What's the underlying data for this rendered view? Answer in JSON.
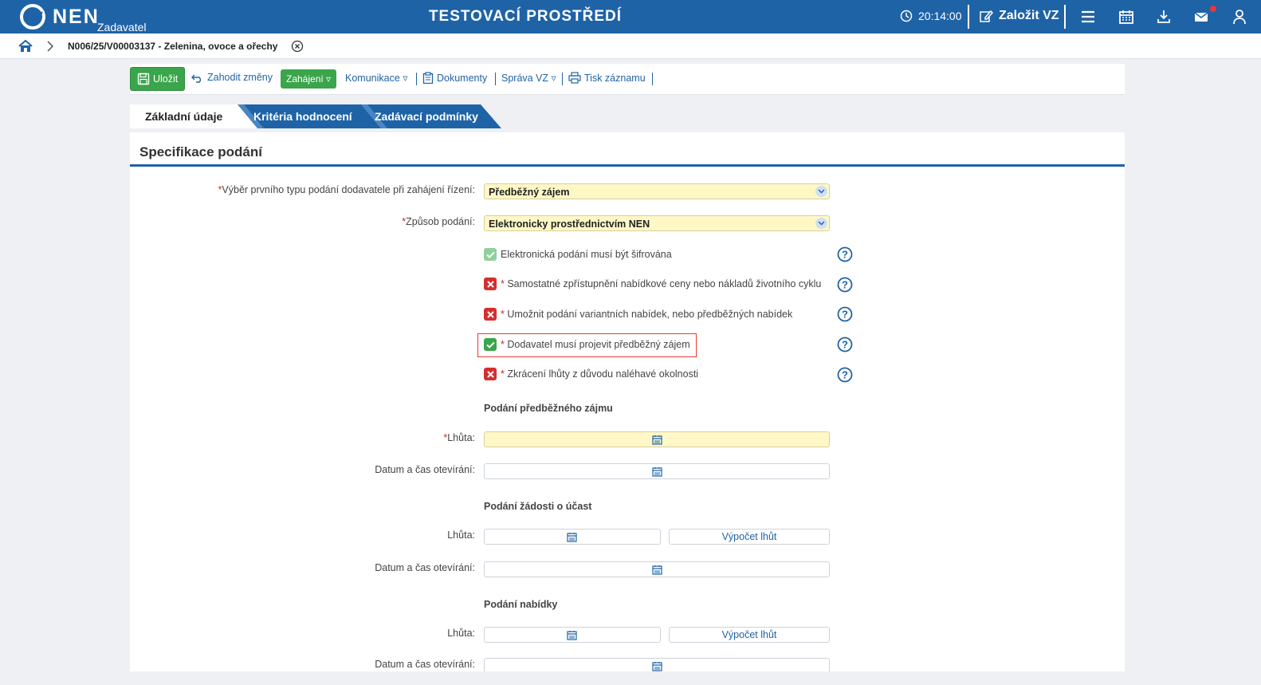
{
  "header": {
    "logo_text": "NEN",
    "logo_sub": "Zadavatel",
    "env_title": "TESTOVACÍ PROSTŘEDÍ",
    "time": "20:14:00",
    "create_label": "Založit VZ",
    "icons": [
      "clock-icon",
      "edit-icon",
      "menu-icon",
      "calendar-icon",
      "download-icon",
      "mail-icon",
      "user-icon"
    ],
    "brand_color": "#1f63a7"
  },
  "breadcrumb": {
    "current": "N006/25/V00003137 - Zelenina, ovoce a ořechy"
  },
  "toolbar": {
    "save_label": "Uložit",
    "discard_label": "Zahodit změny",
    "start_label": "Zahájení ▿",
    "communication_label": "Komunikace ▿",
    "documents_label": "Dokumenty",
    "management_label": "Správa VZ ▿",
    "print_label": "Tisk záznamu"
  },
  "tabs": [
    {
      "label": "Základní údaje",
      "active": true
    },
    {
      "label": "Kritéria hodnocení",
      "active": false
    },
    {
      "label": "Zadávací podmínky",
      "active": false
    }
  ],
  "section": {
    "title": "Specifikace podání"
  },
  "fields": {
    "first_type_label": "Výběr prvního typu podání dodavatele při zahájení řízení:",
    "first_type_value": "Předběžný zájem",
    "method_label": "Způsob podání:",
    "method_value": "Elektronicky prostřednictvím NEN"
  },
  "checkboxes": [
    {
      "label": "Elektronická podání musí být šifrována",
      "state": "checked-disabled",
      "required": false
    },
    {
      "label": "Samostatné zpřístupnění nabídkové ceny nebo nákladů životního cyklu",
      "state": "unchecked",
      "required": true
    },
    {
      "label": "Umožnit podání variantních nabídek, nebo předběžných nabídek",
      "state": "unchecked",
      "required": true
    },
    {
      "label": "Dodavatel musí projevit předběžný zájem",
      "state": "checked",
      "required": true
    },
    {
      "label": "Zkrácení lhůty z důvodu naléhavé okolnosti",
      "state": "unchecked",
      "required": true
    }
  ],
  "groups": {
    "interest_title": "Podání předběžného zájmu",
    "request_title": "Podání žádosti o účast",
    "offer_title": "Podání nabídky",
    "deadline_label": "Lhůta:",
    "opening_label": "Datum a čas otevírání:",
    "calc_label": "Výpočet lhůt"
  },
  "colors": {
    "accent": "#1f63a7",
    "green": "#3aa54b",
    "required_bg": "#fff8c6",
    "error_red": "#d32f2f",
    "highlight": "#e53935"
  }
}
